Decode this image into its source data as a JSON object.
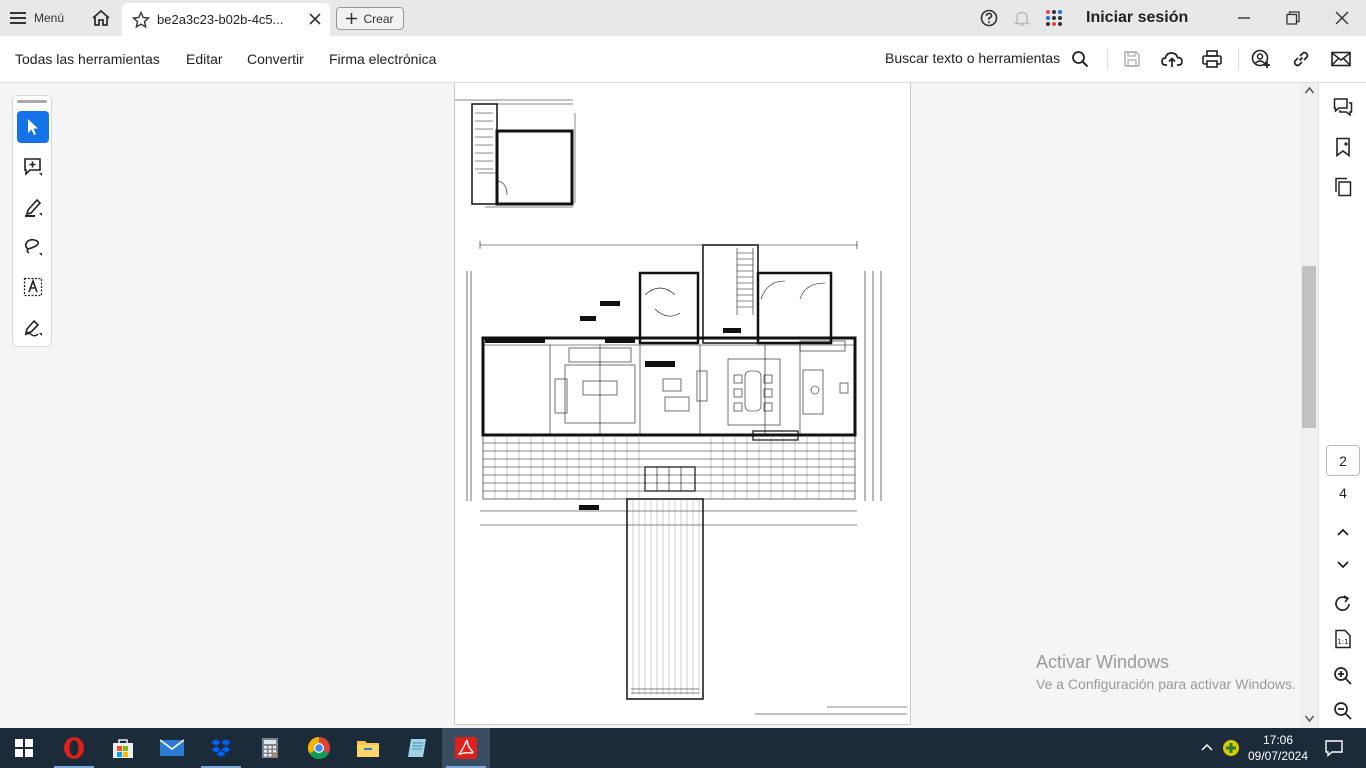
{
  "titlebar": {
    "menu_label": "Menú",
    "tab_title": "be2a3c23-b02b-4c5...",
    "create_label": "Crear",
    "signin_label": "Iniciar sesión"
  },
  "toolbar": {
    "items": [
      "Todas las herramientas",
      "Editar",
      "Convertir",
      "Firma electrónica"
    ],
    "search_label": "Buscar texto o herramientas"
  },
  "left_tools": [
    "select-tool",
    "add-comment-tool",
    "highlight-tool",
    "draw-tool",
    "text-select-tool",
    "sign-tool"
  ],
  "page_nav": {
    "current": "2",
    "total": "4"
  },
  "watermark": {
    "title": "Activar Windows",
    "subtitle": "Ve a Configuración para activar Windows."
  },
  "taskbar": {
    "apps": [
      "start",
      "opera",
      "store",
      "mail",
      "dropbox",
      "calculator",
      "chrome",
      "explorer",
      "notes",
      "acrobat"
    ],
    "time": "17:06",
    "date": "09/07/2024"
  },
  "colors": {
    "accent": "#1473e6",
    "acrobat_red": "#e0201b",
    "taskbar": "#1c2b3a"
  }
}
